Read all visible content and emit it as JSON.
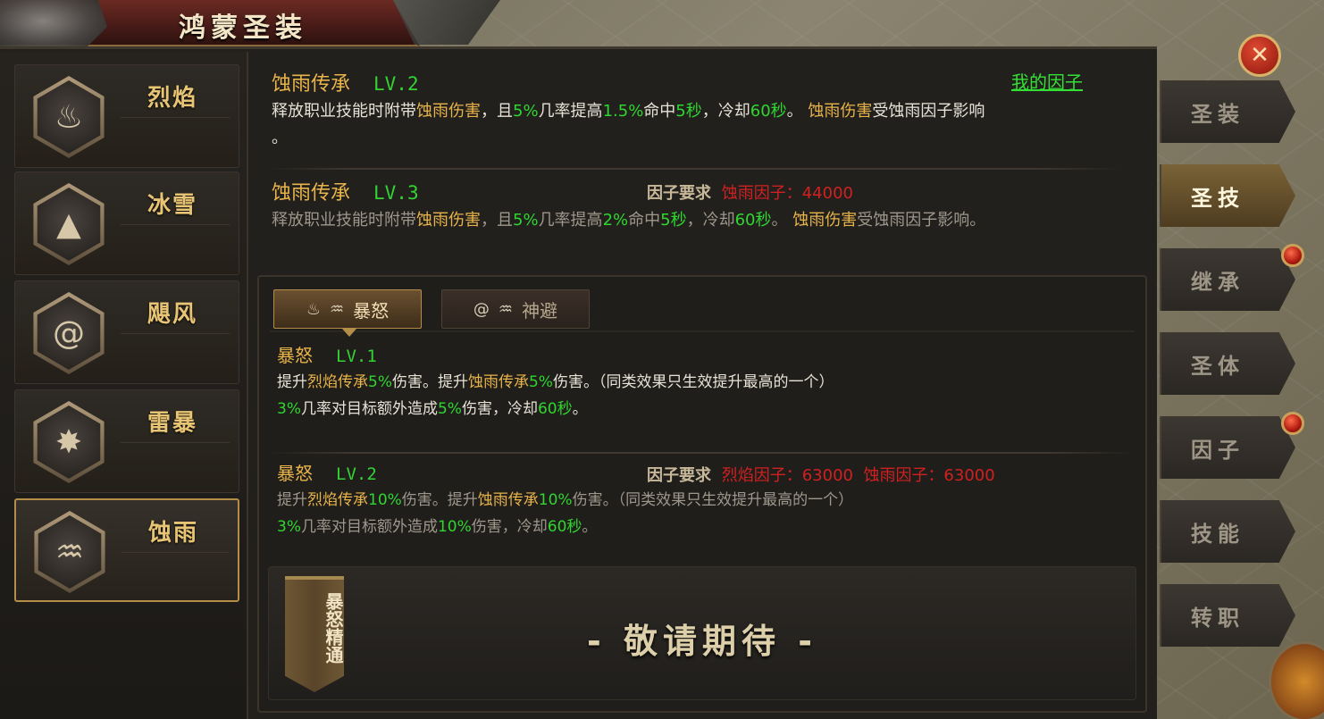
{
  "window": {
    "title": "鸿蒙圣装"
  },
  "categories": [
    {
      "name": "烈焰",
      "icon": "flame-icon"
    },
    {
      "name": "冰雪",
      "icon": "mountain-icon"
    },
    {
      "name": "飓风",
      "icon": "whirlwind-icon"
    },
    {
      "name": "雷暴",
      "icon": "thunder-icon"
    },
    {
      "name": "蚀雨",
      "icon": "rain-drop-icon"
    }
  ],
  "selected_category": "蚀雨",
  "my_factor_link": "我的因子",
  "inheritance": {
    "lv2": {
      "name": "蚀雨传承",
      "level": "LV.2",
      "d1": "释放职业技能时附带",
      "d2": "蚀雨伤害",
      "d3": "，且",
      "d4": "5%",
      "d5": "几率提高",
      "d6": "1.5%",
      "d7": "命中",
      "d8": "5秒",
      "d9": "，冷却",
      "d10": "60秒",
      "d11": "。 ",
      "d12": "蚀雨伤害",
      "d13": "受蚀雨因子影响",
      "d14": "。"
    },
    "lv3": {
      "name": "蚀雨传承",
      "level": "LV.3",
      "req_label": "因子要求",
      "req_value": "蚀雨因子：44000",
      "d1": "释放职业技能时附带",
      "d2": "蚀雨伤害",
      "d3": "，且",
      "d4": "5%",
      "d5": "几率提高",
      "d6": "2%",
      "d7": "命中",
      "d8": "5秒",
      "d9": "，冷却",
      "d10": "60秒",
      "d11": "。 ",
      "d12": "蚀雨伤害",
      "d13": "受蚀雨因子影响。"
    }
  },
  "tabs": [
    {
      "label": "暴怒",
      "active": true
    },
    {
      "label": "神避",
      "active": false
    }
  ],
  "rage": {
    "lv1": {
      "name": "暴怒",
      "level": "LV.1",
      "l1a": "提升",
      "l1b": "烈焰传承",
      "l1c": "5%",
      "l1d": "伤害。提升",
      "l1e": "蚀雨传承",
      "l1f": "5%",
      "l1g": "伤害。（同类效果只生效提升最高的一个）",
      "l2a": "3%",
      "l2b": "几率对目标额外造成",
      "l2c": "5%",
      "l2d": "伤害，冷却",
      "l2e": "60秒",
      "l2f": "。"
    },
    "lv2": {
      "name": "暴怒",
      "level": "LV.2",
      "req_label": "因子要求",
      "req_value": "烈焰因子：63000  蚀雨因子：63000",
      "l1a": "提升",
      "l1b": "烈焰传承",
      "l1c": "10%",
      "l1d": "伤害。提升",
      "l1e": "蚀雨传承",
      "l1f": "10%",
      "l1g": "伤害。（同类效果只生效提升最高的一个）",
      "l2a": "3%",
      "l2b": "几率对目标额外造成",
      "l2c": "10%",
      "l2d": "伤害，冷却",
      "l2e": "60秒",
      "l2f": "。"
    }
  },
  "mastery": {
    "banner": "暴怒精通",
    "coming_soon": "- 敬请期待 -"
  },
  "right_tabs": [
    {
      "label": "圣装",
      "active": false,
      "dot": false
    },
    {
      "label": "圣技",
      "active": true,
      "dot": false
    },
    {
      "label": "继承",
      "active": false,
      "dot": true
    },
    {
      "label": "圣体",
      "active": false,
      "dot": false
    },
    {
      "label": "因子",
      "active": false,
      "dot": true
    },
    {
      "label": "技能",
      "active": false,
      "dot": false
    },
    {
      "label": "转职",
      "active": false,
      "dot": false
    }
  ],
  "close_icon": "close-icon"
}
